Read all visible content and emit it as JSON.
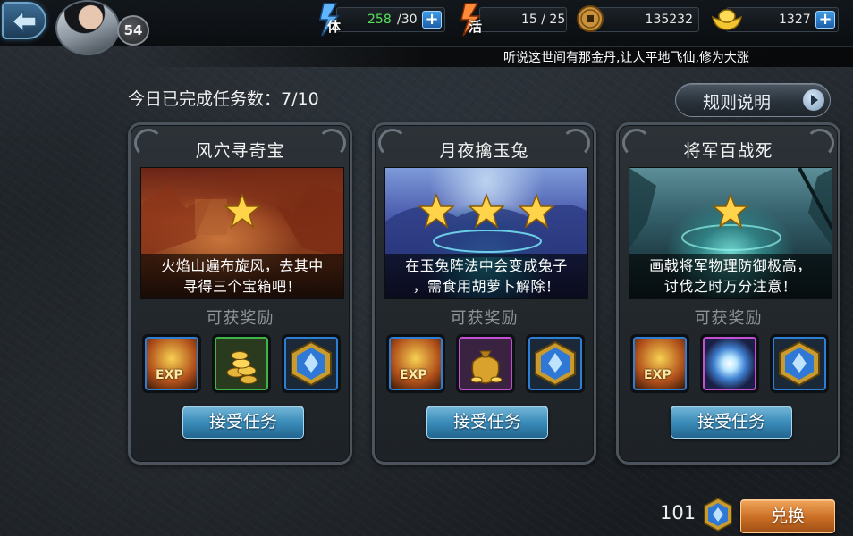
{
  "player": {
    "level": "54",
    "stamina": {
      "glyph": "体",
      "current": "258",
      "max": "/30"
    },
    "activity": {
      "glyph": "活",
      "value": "15 / 25"
    },
    "coins": "135232",
    "gold": "1327"
  },
  "ticker": "听说这世间有那金丹,让人平地飞仙,修为大涨",
  "header": {
    "completed_text": "今日已完成任务数：7/10",
    "rules_label": "规则说明"
  },
  "reward_label": "可获奖励",
  "accept_label": "接受任务",
  "quests": [
    {
      "title": "风穴寻奇宝",
      "stars": 1,
      "desc_line1": "火焰山遍布旋风，去其中",
      "desc_line2": "寻得三个宝箱吧！",
      "rewards": [
        "exp-icon",
        "gold-coins-icon",
        "blue-gem-icon"
      ]
    },
    {
      "title": "月夜擒玉兔",
      "stars": 3,
      "desc_line1": "在玉兔阵法中会变成兔子",
      "desc_line2": "，需食用胡萝卜解除！",
      "rewards": [
        "exp-icon",
        "gold-pouch-icon",
        "blue-gem-icon"
      ]
    },
    {
      "title": "将军百战死",
      "stars": 1,
      "desc_line1": "画戟将军物理防御极高，",
      "desc_line2": "讨伐之时万分注意！",
      "rewards": [
        "exp-icon",
        "spirit-orb-icon",
        "blue-gem-icon"
      ]
    }
  ],
  "exp_text": "EXP",
  "gem_balance": "101",
  "exchange_label": "兑换",
  "colors": {
    "accent_blue": "#3b8cb9",
    "exchange_orange": "#c96d24",
    "stamina_green": "#58e05a"
  }
}
